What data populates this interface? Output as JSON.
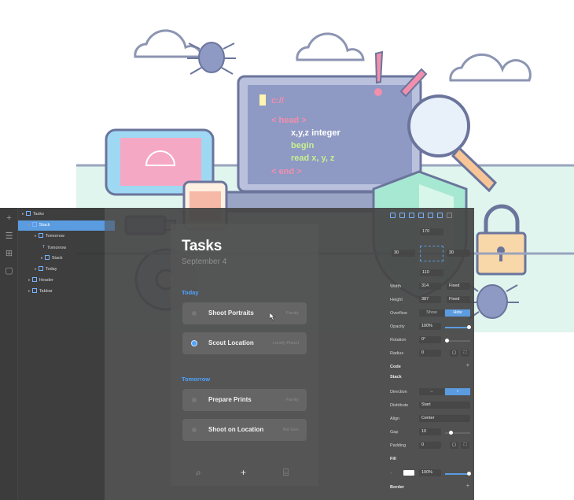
{
  "colors": {
    "accent": "#5b9be0",
    "today_blue": "#4fa3ff",
    "panel_dark": "#3a3a3a"
  },
  "illustration": {
    "prompt": "c://",
    "code_lines": [
      "< head >",
      "x,y,z integer",
      "begin",
      "read x, y, z",
      "< end >"
    ]
  },
  "rail": {
    "icons": [
      "plus-icon",
      "list-icon",
      "grid-icon",
      "box-icon"
    ]
  },
  "layers": [
    {
      "label": "Tasks",
      "depth": 0,
      "kind": "stack",
      "selected": false
    },
    {
      "label": "Stack",
      "depth": 1,
      "kind": "stack",
      "selected": true
    },
    {
      "label": "Tomorrow",
      "depth": 2,
      "kind": "stack",
      "selected": false
    },
    {
      "label": "Tomorrow",
      "depth": 3,
      "kind": "text",
      "selected": false
    },
    {
      "label": "Stack",
      "depth": 3,
      "kind": "stack",
      "selected": false
    },
    {
      "label": "Today",
      "depth": 2,
      "kind": "stack",
      "selected": false
    },
    {
      "label": "Header",
      "depth": 1,
      "kind": "stack",
      "selected": false
    },
    {
      "label": "Tabbar",
      "depth": 1,
      "kind": "stack",
      "selected": false
    }
  ],
  "phone": {
    "title": "Tasks",
    "date": "September 4",
    "today_label": "Today",
    "tomorrow_label": "Tomorrow",
    "today_tasks": [
      {
        "label": "Shoot Portraits",
        "tag": "Family",
        "done": false
      },
      {
        "label": "Scout Location",
        "tag": "Lonely Planet",
        "done": true
      }
    ],
    "tomorrow_tasks": [
      {
        "label": "Prepare Prints",
        "tag": "Family",
        "done": false
      },
      {
        "label": "Shoot on Location",
        "tag": "Nat Geo",
        "done": false
      }
    ],
    "tabbar": {
      "search": "⌕",
      "add": "+",
      "archive": "⌸"
    }
  },
  "inspector": {
    "spacing": {
      "top": "170",
      "left": "30",
      "right": "30",
      "bottom": "110"
    },
    "width": {
      "label": "Width",
      "value": "314",
      "mode": "Fixed"
    },
    "height": {
      "label": "Height",
      "value": "387",
      "mode": "Fixed"
    },
    "overflow": {
      "label": "Overflow",
      "show": "Show",
      "hide": "Hide"
    },
    "opacity": {
      "label": "Opacity",
      "value": "100%",
      "level": 1.0
    },
    "rotation": {
      "label": "Rotation",
      "value": "0°",
      "level": 0.0
    },
    "radius": {
      "label": "Radius",
      "value": "0"
    },
    "code_header": "Code",
    "stack_header": "Stack",
    "direction": {
      "label": "Direction"
    },
    "distribute": {
      "label": "Distribute",
      "value": "Start"
    },
    "align": {
      "label": "Align",
      "value": "Center"
    },
    "gap": {
      "label": "Gap",
      "value": "10",
      "level": 0.15
    },
    "padding": {
      "label": "Padding",
      "value": "0"
    },
    "fill_header": "Fill",
    "fill": {
      "opacity": "100%",
      "level": 1.0,
      "color": "#ffffff"
    },
    "border_header": "Border"
  }
}
